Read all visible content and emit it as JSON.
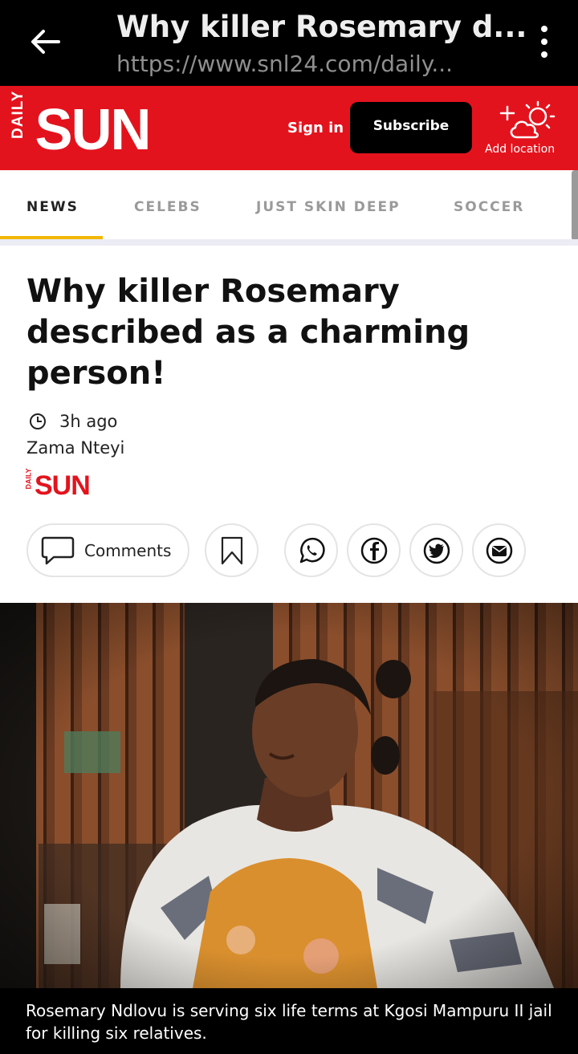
{
  "browser": {
    "title": "Why killer Rosemary d...",
    "url": "https://www.snl24.com/daily..."
  },
  "header": {
    "logo_top": "DAILY",
    "logo_main": "SUN",
    "signin_label": "Sign in",
    "subscribe_label": "Subscribe",
    "weather_label": "Add location",
    "brand_color": "#e3131d"
  },
  "nav": {
    "tabs": [
      {
        "label": "NEWS",
        "active": true
      },
      {
        "label": "CELEBS",
        "active": false
      },
      {
        "label": "JUST SKIN DEEP",
        "active": false
      },
      {
        "label": "SOCCER",
        "active": false
      }
    ],
    "accent_color": "#f2b705"
  },
  "article": {
    "headline": "Why killer Rosemary described as a charming person!",
    "time": "3h ago",
    "author": "Zama Nteyi",
    "publisher_logo_top": "DAILY",
    "publisher_logo_main": "SUN",
    "comments_label": "Comments",
    "share_icons": [
      "bookmark-icon",
      "whatsapp-icon",
      "facebook-icon",
      "twitter-icon",
      "email-icon"
    ],
    "caption": "Rosemary Ndlovu is serving six life terms at Kgosi Mampuru II jail for killing six relatives."
  }
}
